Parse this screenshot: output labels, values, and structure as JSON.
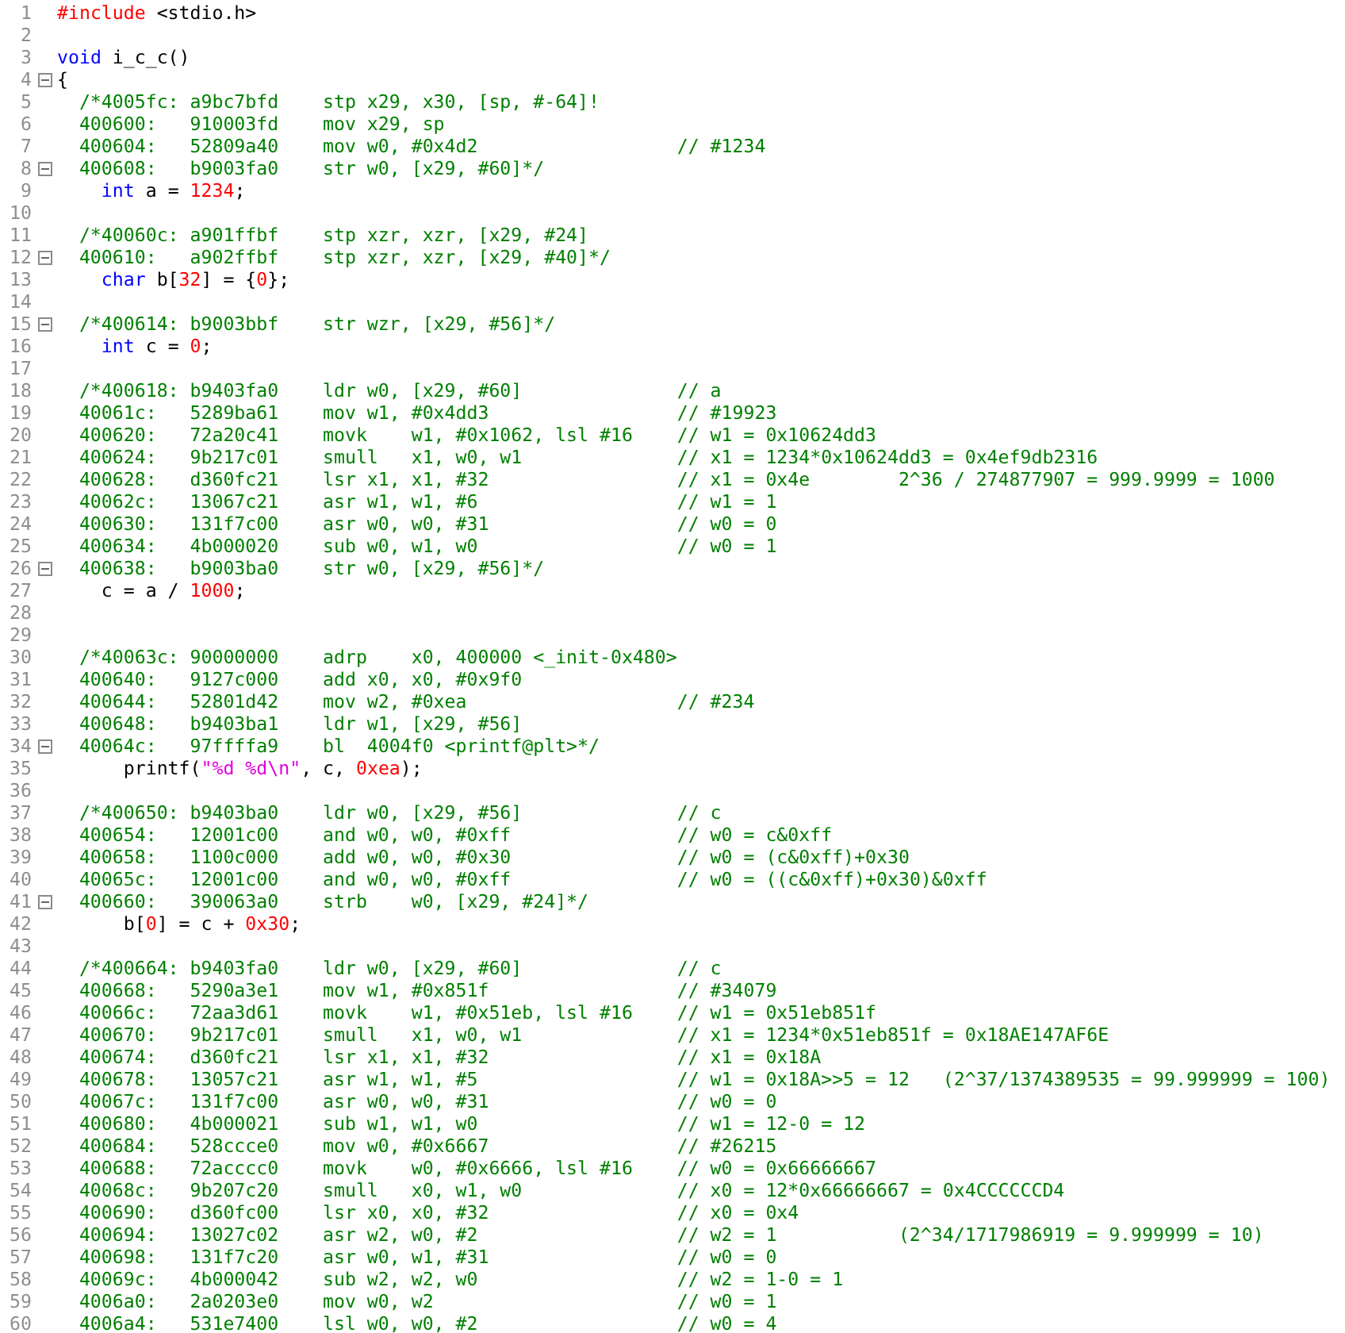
{
  "editor": {
    "lines": [
      {
        "number": "1",
        "fold_marker": false,
        "kind": "code",
        "tokens": [
          {
            "kind": "preprocessor",
            "text": "#include"
          },
          {
            "kind": "plain",
            "text": " <stdio.h>"
          }
        ]
      },
      {
        "number": "2",
        "fold_marker": false,
        "kind": "blank"
      },
      {
        "number": "3",
        "fold_marker": false,
        "kind": "code",
        "tokens": [
          {
            "kind": "keyword",
            "text": "void"
          },
          {
            "kind": "plain",
            "text": " i_c_c()"
          }
        ]
      },
      {
        "number": "4",
        "fold_marker": true,
        "kind": "code",
        "tokens": [
          {
            "kind": "plain",
            "text": "{"
          }
        ]
      },
      {
        "number": "5",
        "fold_marker": false,
        "kind": "asm",
        "address": "/*4005fc:",
        "opcode": "a9bc7bfd",
        "instruction": "stp x29, x30, [sp, #-64]!"
      },
      {
        "number": "6",
        "fold_marker": false,
        "kind": "asm",
        "address": "400600:",
        "opcode": "910003fd",
        "instruction": "mov x29, sp"
      },
      {
        "number": "7",
        "fold_marker": false,
        "kind": "asm",
        "address": "400604:",
        "opcode": "52809a40",
        "instruction": "mov w0, #0x4d2",
        "comment": "// #1234"
      },
      {
        "number": "8",
        "fold_marker": true,
        "kind": "asm",
        "address": "400608:",
        "opcode": "b9003fa0",
        "instruction": "str w0, [x29, #60]*/"
      },
      {
        "number": "9",
        "fold_marker": false,
        "kind": "code",
        "tokens": [
          {
            "kind": "keyword",
            "text": "    int"
          },
          {
            "kind": "plain",
            "text": " a = "
          },
          {
            "kind": "number",
            "text": "1234"
          },
          {
            "kind": "plain",
            "text": ";"
          }
        ]
      },
      {
        "number": "10",
        "fold_marker": false,
        "kind": "blank"
      },
      {
        "number": "11",
        "fold_marker": false,
        "kind": "asm",
        "address": "/*40060c:",
        "opcode": "a901ffbf",
        "instruction": "stp xzr, xzr, [x29, #24]"
      },
      {
        "number": "12",
        "fold_marker": true,
        "kind": "asm",
        "address": "400610:",
        "opcode": "a902ffbf",
        "instruction": "stp xzr, xzr, [x29, #40]*/"
      },
      {
        "number": "13",
        "fold_marker": false,
        "kind": "code",
        "tokens": [
          {
            "kind": "keyword",
            "text": "    char"
          },
          {
            "kind": "plain",
            "text": " b["
          },
          {
            "kind": "number",
            "text": "32"
          },
          {
            "kind": "plain",
            "text": "] = {"
          },
          {
            "kind": "number",
            "text": "0"
          },
          {
            "kind": "plain",
            "text": "};"
          }
        ]
      },
      {
        "number": "14",
        "fold_marker": false,
        "kind": "blank"
      },
      {
        "number": "15",
        "fold_marker": true,
        "kind": "asm",
        "address": "/*400614:",
        "opcode": "b9003bbf",
        "instruction": "str wzr, [x29, #56]*/"
      },
      {
        "number": "16",
        "fold_marker": false,
        "kind": "code",
        "tokens": [
          {
            "kind": "keyword",
            "text": "    int"
          },
          {
            "kind": "plain",
            "text": " c = "
          },
          {
            "kind": "number",
            "text": "0"
          },
          {
            "kind": "plain",
            "text": ";"
          }
        ]
      },
      {
        "number": "17",
        "fold_marker": false,
        "kind": "blank"
      },
      {
        "number": "18",
        "fold_marker": false,
        "kind": "asm",
        "address": "/*400618:",
        "opcode": "b9403fa0",
        "instruction": "ldr w0, [x29, #60]",
        "comment": "// a"
      },
      {
        "number": "19",
        "fold_marker": false,
        "kind": "asm",
        "address": "40061c:",
        "opcode": "5289ba61",
        "instruction": "mov w1, #0x4dd3",
        "comment": "// #19923"
      },
      {
        "number": "20",
        "fold_marker": false,
        "kind": "asm",
        "address": "400620:",
        "opcode": "72a20c41",
        "instruction": "movk    w1, #0x1062, lsl #16",
        "comment": "// w1 = 0x10624dd3"
      },
      {
        "number": "21",
        "fold_marker": false,
        "kind": "asm",
        "address": "400624:",
        "opcode": "9b217c01",
        "instruction": "smull   x1, w0, w1",
        "comment": "// x1 = 1234*0x10624dd3 = 0x4ef9db2316"
      },
      {
        "number": "22",
        "fold_marker": false,
        "kind": "asm",
        "address": "400628:",
        "opcode": "d360fc21",
        "instruction": "lsr x1, x1, #32",
        "comment": "// x1 = 0x4e",
        "note": "2^36 / 274877907 = 999.9999 = 1000"
      },
      {
        "number": "23",
        "fold_marker": false,
        "kind": "asm",
        "address": "40062c:",
        "opcode": "13067c21",
        "instruction": "asr w1, w1, #6",
        "comment": "// w1 = 1"
      },
      {
        "number": "24",
        "fold_marker": false,
        "kind": "asm",
        "address": "400630:",
        "opcode": "131f7c00",
        "instruction": "asr w0, w0, #31",
        "comment": "// w0 = 0"
      },
      {
        "number": "25",
        "fold_marker": false,
        "kind": "asm",
        "address": "400634:",
        "opcode": "4b000020",
        "instruction": "sub w0, w1, w0",
        "comment": "// w0 = 1"
      },
      {
        "number": "26",
        "fold_marker": true,
        "kind": "asm",
        "address": "400638:",
        "opcode": "b9003ba0",
        "instruction": "str w0, [x29, #56]*/"
      },
      {
        "number": "27",
        "fold_marker": false,
        "kind": "code",
        "tokens": [
          {
            "kind": "plain",
            "text": "    c = a / "
          },
          {
            "kind": "number",
            "text": "1000"
          },
          {
            "kind": "plain",
            "text": ";"
          }
        ]
      },
      {
        "number": "28",
        "fold_marker": false,
        "kind": "blank"
      },
      {
        "number": "29",
        "fold_marker": false,
        "kind": "blank"
      },
      {
        "number": "30",
        "fold_marker": false,
        "kind": "asm",
        "address": "/*40063c:",
        "opcode": "90000000",
        "instruction": "adrp    x0, 400000 <_init-0x480>"
      },
      {
        "number": "31",
        "fold_marker": false,
        "kind": "asm",
        "address": "400640:",
        "opcode": "9127c000",
        "instruction": "add x0, x0, #0x9f0"
      },
      {
        "number": "32",
        "fold_marker": false,
        "kind": "asm",
        "address": "400644:",
        "opcode": "52801d42",
        "instruction": "mov w2, #0xea",
        "comment": "// #234"
      },
      {
        "number": "33",
        "fold_marker": false,
        "kind": "asm",
        "address": "400648:",
        "opcode": "b9403ba1",
        "instruction": "ldr w1, [x29, #56]"
      },
      {
        "number": "34",
        "fold_marker": true,
        "kind": "asm",
        "address": "40064c:",
        "opcode": "97ffffa9",
        "instruction": "bl  4004f0 <printf@plt>*/"
      },
      {
        "number": "35",
        "fold_marker": false,
        "kind": "code",
        "tokens": [
          {
            "kind": "plain",
            "text": "      printf("
          },
          {
            "kind": "string",
            "text": "\"%d %d\\n\""
          },
          {
            "kind": "plain",
            "text": ", c, "
          },
          {
            "kind": "number",
            "text": "0xea"
          },
          {
            "kind": "plain",
            "text": ");"
          }
        ]
      },
      {
        "number": "36",
        "fold_marker": false,
        "kind": "blank"
      },
      {
        "number": "37",
        "fold_marker": false,
        "kind": "asm",
        "address": "/*400650:",
        "opcode": "b9403ba0",
        "instruction": "ldr w0, [x29, #56]",
        "comment": "// c"
      },
      {
        "number": "38",
        "fold_marker": false,
        "kind": "asm",
        "address": "400654:",
        "opcode": "12001c00",
        "instruction": "and w0, w0, #0xff",
        "comment": "// w0 = c&0xff"
      },
      {
        "number": "39",
        "fold_marker": false,
        "kind": "asm",
        "address": "400658:",
        "opcode": "1100c000",
        "instruction": "add w0, w0, #0x30",
        "comment": "// w0 = (c&0xff)+0x30"
      },
      {
        "number": "40",
        "fold_marker": false,
        "kind": "asm",
        "address": "40065c:",
        "opcode": "12001c00",
        "instruction": "and w0, w0, #0xff",
        "comment": "// w0 = ((c&0xff)+0x30)&0xff"
      },
      {
        "number": "41",
        "fold_marker": true,
        "kind": "asm",
        "address": "400660:",
        "opcode": "390063a0",
        "instruction": "strb    w0, [x29, #24]*/"
      },
      {
        "number": "42",
        "fold_marker": false,
        "kind": "code",
        "tokens": [
          {
            "kind": "plain",
            "text": "      b["
          },
          {
            "kind": "number",
            "text": "0"
          },
          {
            "kind": "plain",
            "text": "] = c + "
          },
          {
            "kind": "number",
            "text": "0x30"
          },
          {
            "kind": "plain",
            "text": ";"
          }
        ]
      },
      {
        "number": "43",
        "fold_marker": false,
        "kind": "blank"
      },
      {
        "number": "44",
        "fold_marker": false,
        "kind": "asm",
        "address": "/*400664:",
        "opcode": "b9403fa0",
        "instruction": "ldr w0, [x29, #60]",
        "comment": "// c"
      },
      {
        "number": "45",
        "fold_marker": false,
        "kind": "asm",
        "address": "400668:",
        "opcode": "5290a3e1",
        "instruction": "mov w1, #0x851f",
        "comment": "// #34079"
      },
      {
        "number": "46",
        "fold_marker": false,
        "kind": "asm",
        "address": "40066c:",
        "opcode": "72aa3d61",
        "instruction": "movk    w1, #0x51eb, lsl #16",
        "comment": "// w1 = 0x51eb851f"
      },
      {
        "number": "47",
        "fold_marker": false,
        "kind": "asm",
        "address": "400670:",
        "opcode": "9b217c01",
        "instruction": "smull   x1, w0, w1",
        "comment": "// x1 = 1234*0x51eb851f = 0x18AE147AF6E"
      },
      {
        "number": "48",
        "fold_marker": false,
        "kind": "asm",
        "address": "400674:",
        "opcode": "d360fc21",
        "instruction": "lsr x1, x1, #32",
        "comment": "// x1 = 0x18A"
      },
      {
        "number": "49",
        "fold_marker": false,
        "kind": "asm",
        "address": "400678:",
        "opcode": "13057c21",
        "instruction": "asr w1, w1, #5",
        "comment": "// w1 = 0x18A>>5 = 12",
        "note": "(2^37/1374389535 = 99.999999 = 100)"
      },
      {
        "number": "50",
        "fold_marker": false,
        "kind": "asm",
        "address": "40067c:",
        "opcode": "131f7c00",
        "instruction": "asr w0, w0, #31",
        "comment": "// w0 = 0"
      },
      {
        "number": "51",
        "fold_marker": false,
        "kind": "asm",
        "address": "400680:",
        "opcode": "4b000021",
        "instruction": "sub w1, w1, w0",
        "comment": "// w1 = 12-0 = 12"
      },
      {
        "number": "52",
        "fold_marker": false,
        "kind": "asm",
        "address": "400684:",
        "opcode": "528ccce0",
        "instruction": "mov w0, #0x6667",
        "comment": "// #26215"
      },
      {
        "number": "53",
        "fold_marker": false,
        "kind": "asm",
        "address": "400688:",
        "opcode": "72acccc0",
        "instruction": "movk    w0, #0x6666, lsl #16",
        "comment": "// w0 = 0x66666667"
      },
      {
        "number": "54",
        "fold_marker": false,
        "kind": "asm",
        "address": "40068c:",
        "opcode": "9b207c20",
        "instruction": "smull   x0, w1, w0",
        "comment": "// x0 = 12*0x66666667 = 0x4CCCCCCD4"
      },
      {
        "number": "55",
        "fold_marker": false,
        "kind": "asm",
        "address": "400690:",
        "opcode": "d360fc00",
        "instruction": "lsr x0, x0, #32",
        "comment": "// x0 = 0x4"
      },
      {
        "number": "56",
        "fold_marker": false,
        "kind": "asm",
        "address": "400694:",
        "opcode": "13027c02",
        "instruction": "asr w2, w0, #2",
        "comment": "// w2 = 1",
        "note": "(2^34/1717986919 = 9.999999 = 10)"
      },
      {
        "number": "57",
        "fold_marker": false,
        "kind": "asm",
        "address": "400698:",
        "opcode": "131f7c20",
        "instruction": "asr w0, w1, #31",
        "comment": "// w0 = 0"
      },
      {
        "number": "58",
        "fold_marker": false,
        "kind": "asm",
        "address": "40069c:",
        "opcode": "4b000042",
        "instruction": "sub w2, w2, w0",
        "comment": "// w2 = 1-0 = 1"
      },
      {
        "number": "59",
        "fold_marker": false,
        "kind": "asm",
        "address": "4006a0:",
        "opcode": "2a0203e0",
        "instruction": "mov w0, w2",
        "comment": "// w0 = 1"
      },
      {
        "number": "60",
        "fold_marker": false,
        "kind": "asm",
        "address": "4006a4:",
        "opcode": "531e7400",
        "instruction": "lsl w0, w0, #2",
        "comment": "// w0 = 4"
      }
    ]
  }
}
